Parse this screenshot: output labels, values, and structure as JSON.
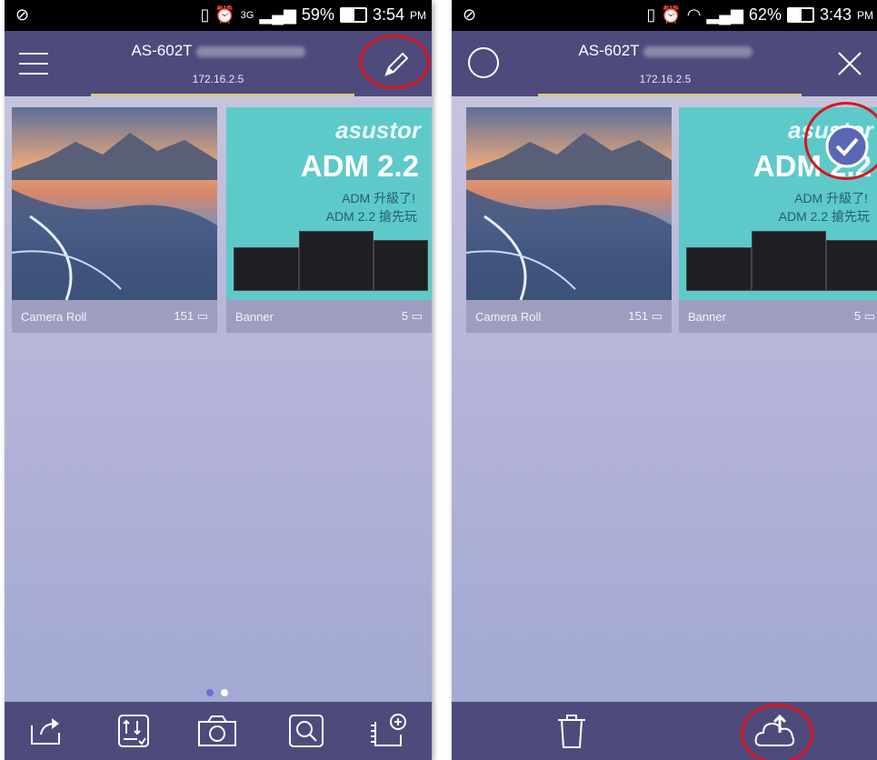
{
  "left": {
    "status": {
      "notify": "⊘",
      "time": "3:54",
      "ampm": "PM",
      "battery": "59%",
      "network": "3G"
    },
    "header": {
      "title": "AS-602T",
      "ip": "172.16.2.5"
    },
    "albums": [
      {
        "name": "Camera Roll",
        "count": "151"
      },
      {
        "name": "Banner",
        "count": "5"
      }
    ],
    "banner": {
      "brand": "asustor",
      "adm": "ADM 2.2",
      "line1": "ADM 升級了!",
      "line2": "ADM 2.2 搶先玩"
    },
    "bottom_buttons": [
      "share-icon",
      "sort-icon",
      "camera-icon",
      "search-icon",
      "add-album-icon"
    ]
  },
  "right": {
    "status": {
      "notify": "⊘",
      "time": "3:43",
      "ampm": "PM",
      "battery": "62%"
    },
    "header": {
      "title": "AS-602T",
      "ip": "172.16.2.5"
    },
    "albums": [
      {
        "name": "Camera Roll",
        "count": "151"
      },
      {
        "name": "Banner",
        "count": "5"
      }
    ],
    "banner": {
      "brand": "asustor",
      "adm": "ADM 2.2",
      "line1": "ADM 升級了!",
      "line2": "ADM 2.2 搶先玩"
    },
    "bottom_buttons": [
      "trash-icon",
      "cloud-upload-icon"
    ]
  },
  "colors": {
    "accent": "#4f4a7c",
    "highlight": "#d9141d",
    "tabline": "#d8c981"
  }
}
